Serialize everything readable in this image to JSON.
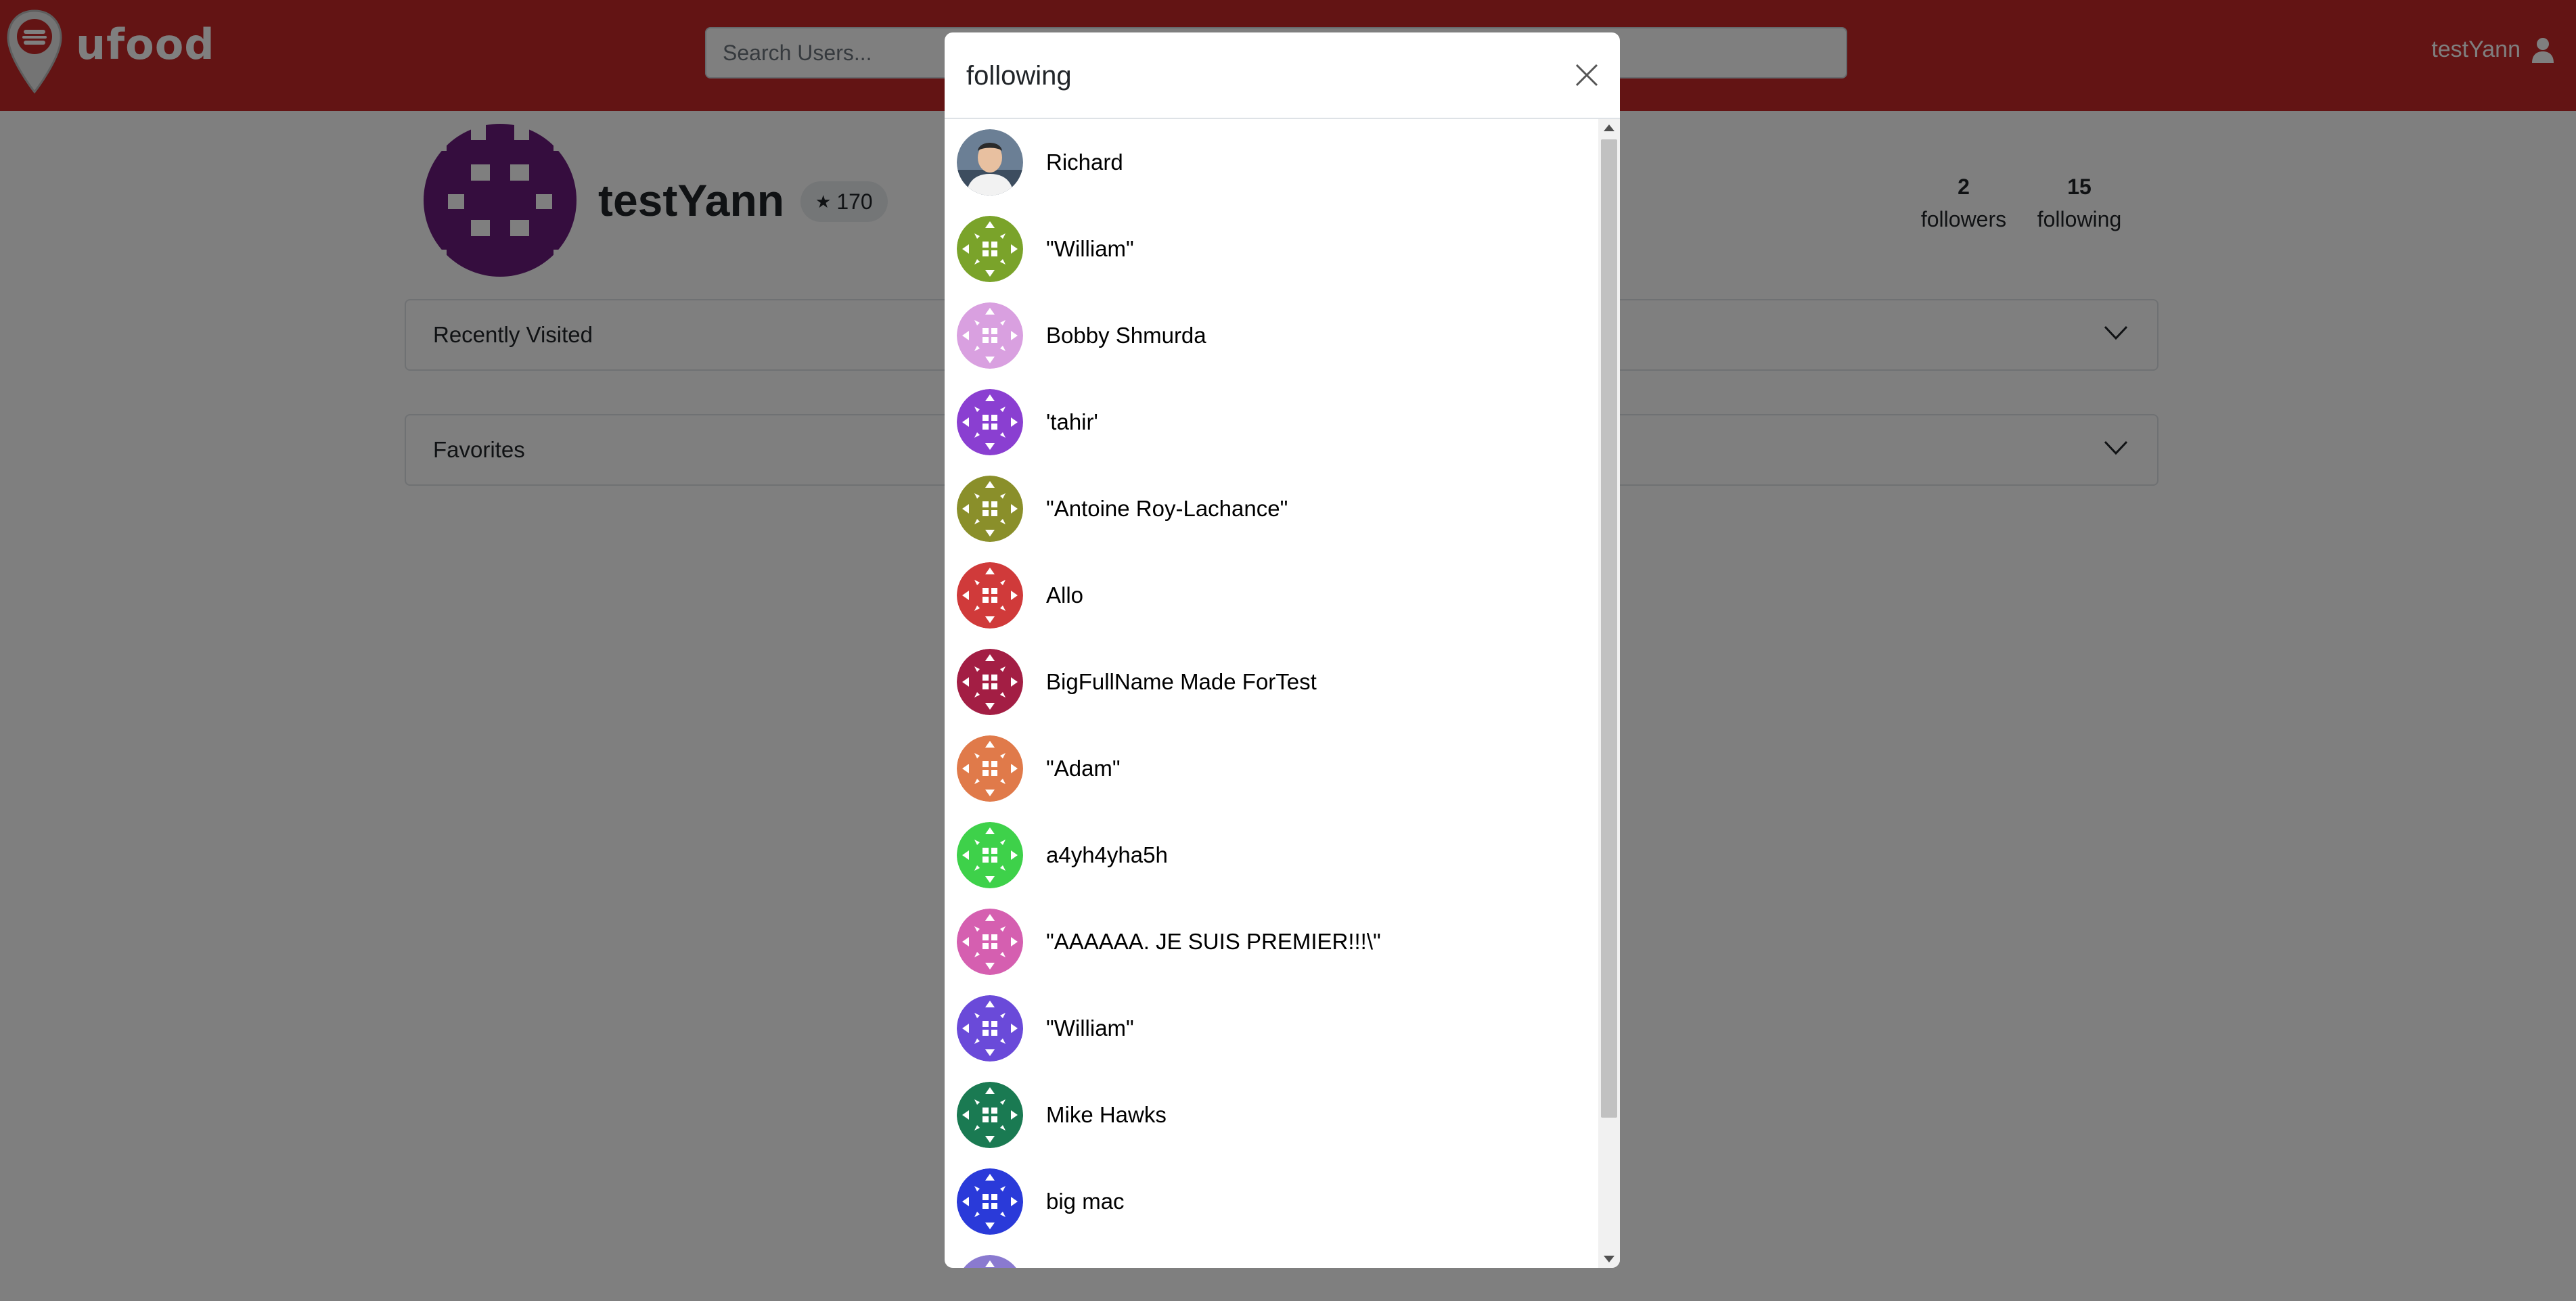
{
  "brand": {
    "name": "ufood",
    "color": "#c62828"
  },
  "search": {
    "placeholder": "Search Users..."
  },
  "user_menu": {
    "username": "testYann",
    "icon": "user-icon"
  },
  "profile": {
    "username": "testYann",
    "rating": "170",
    "rating_icon": "star-icon",
    "avatar_color": "#6a1b7c",
    "followers": {
      "count": "2",
      "label": "followers"
    },
    "following": {
      "count": "15",
      "label": "following"
    }
  },
  "sections": [
    {
      "label": "Recently Visited",
      "icon": "chevron-down-icon"
    },
    {
      "label": "Favorites",
      "icon": "chevron-down-icon"
    }
  ],
  "modal": {
    "title": "following",
    "close_icon": "close-icon",
    "users": [
      {
        "name": "Richard",
        "avatar": "photo",
        "color": "#4a6a8a"
      },
      {
        "name": "\"William\"",
        "avatar": "identicon",
        "color": "#7aa32a"
      },
      {
        "name": "Bobby Shmurda",
        "avatar": "identicon",
        "color": "#d9a0e0"
      },
      {
        "name": "'tahir'",
        "avatar": "identicon",
        "color": "#8a3fd1"
      },
      {
        "name": "\"Antoine Roy-Lachance\"",
        "avatar": "identicon",
        "color": "#8a8f2a"
      },
      {
        "name": "Allo",
        "avatar": "identicon",
        "color": "#d03a3a"
      },
      {
        "name": "BigFullName Made ForTest",
        "avatar": "identicon",
        "color": "#a31e44"
      },
      {
        "name": "\"Adam\"",
        "avatar": "identicon",
        "color": "#e07a4a"
      },
      {
        "name": "a4yh4yha5h",
        "avatar": "identicon",
        "color": "#3ed14a"
      },
      {
        "name": "\"AAAAAA. JE SUIS PREMIER!!!\\\"",
        "avatar": "identicon",
        "color": "#d55fb0"
      },
      {
        "name": "\"William\"",
        "avatar": "identicon",
        "color": "#6a4ad9"
      },
      {
        "name": "Mike Hawks",
        "avatar": "identicon",
        "color": "#1a7a52"
      },
      {
        "name": "big mac",
        "avatar": "identicon",
        "color": "#2a3ad9"
      },
      {
        "name": "",
        "avatar": "identicon",
        "color": "#8a7ad0"
      }
    ]
  }
}
